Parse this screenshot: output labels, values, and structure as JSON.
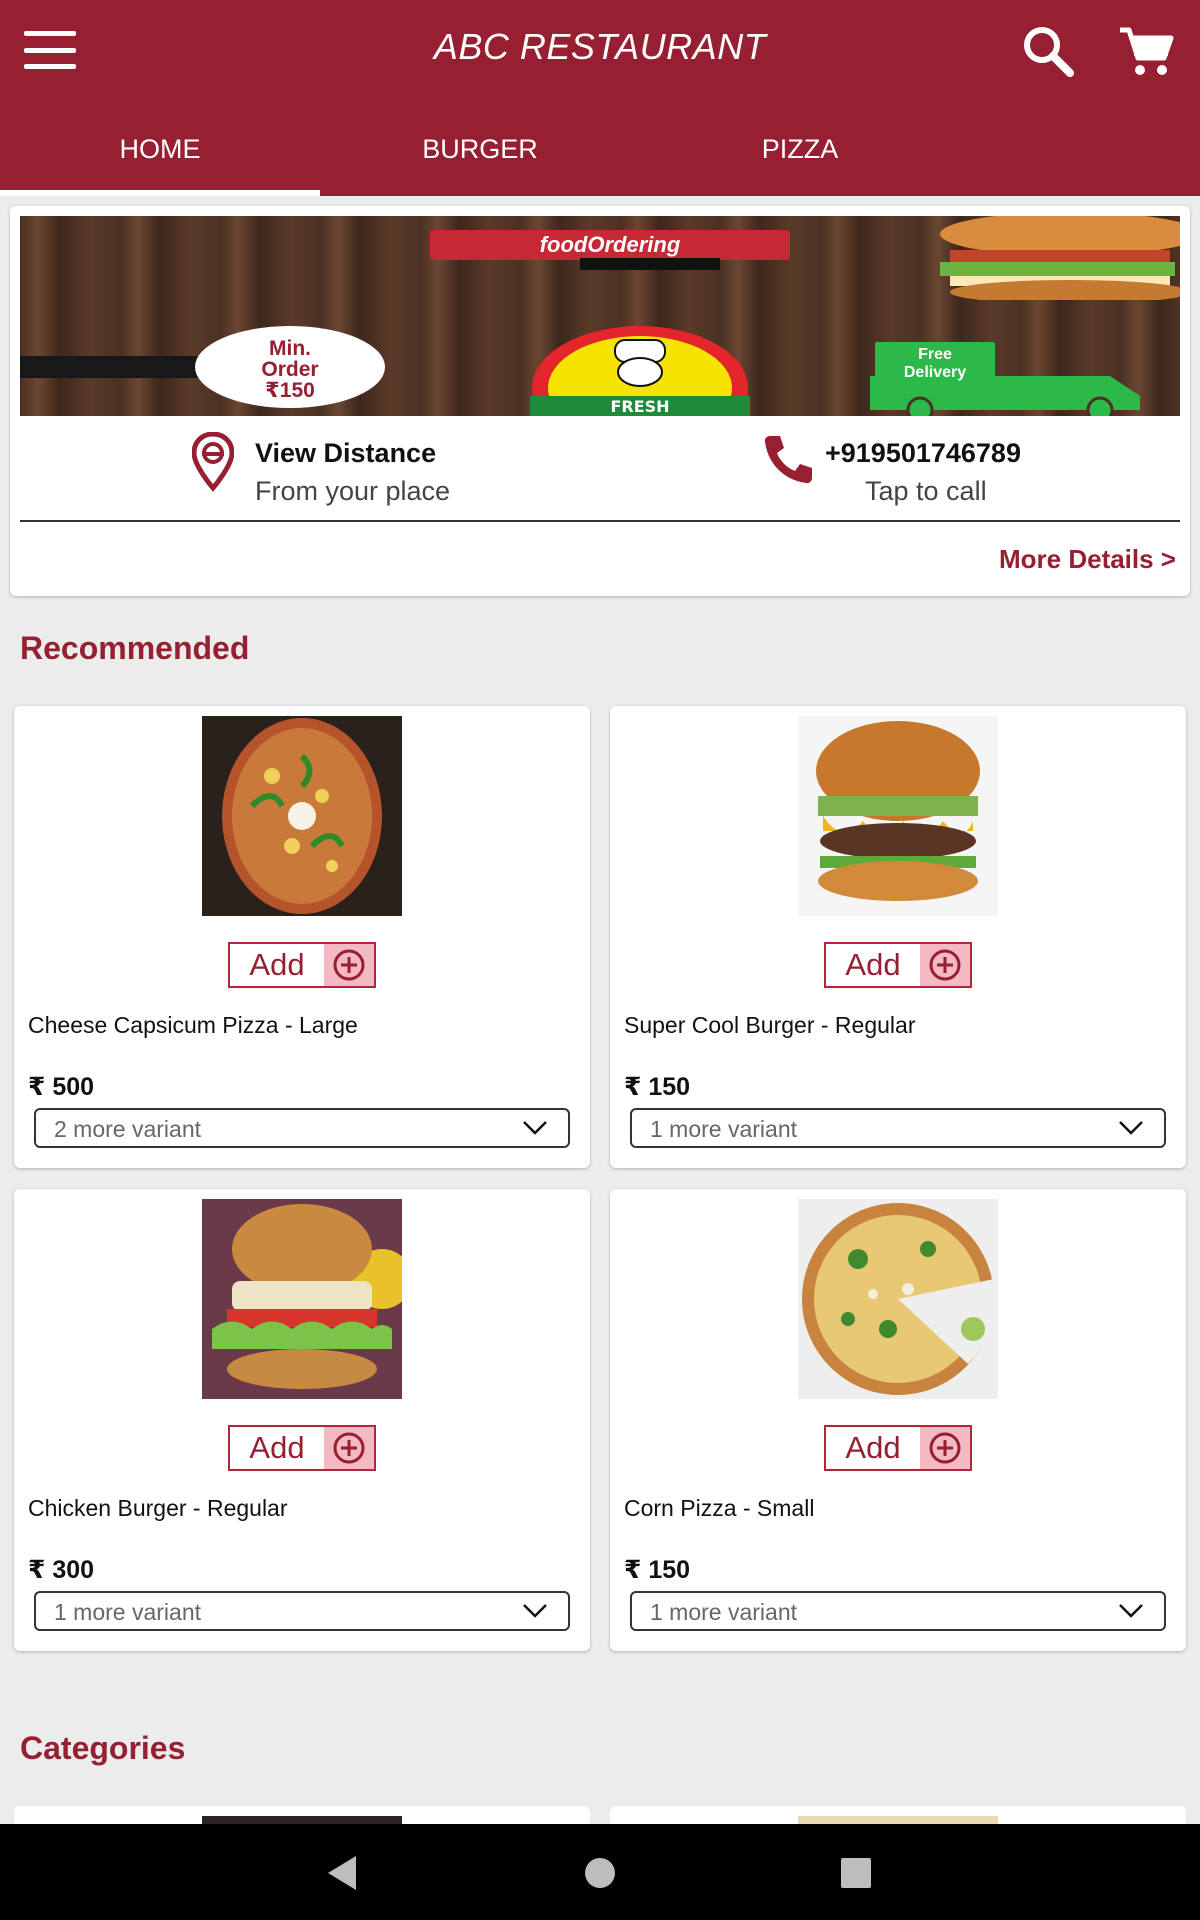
{
  "header": {
    "title": "ABC RESTAURANT",
    "menu_icon": "hamburger-menu-icon",
    "search_icon": "search-icon",
    "cart_icon": "shopping-cart-icon",
    "bar_color": "#962031"
  },
  "tabs": [
    {
      "label": "HOME",
      "active": true
    },
    {
      "label": "BURGER",
      "active": false
    },
    {
      "label": "PIZZA",
      "active": false
    }
  ],
  "banner": {
    "brand": "foodOrdering",
    "min_order": [
      "Min.",
      "Order",
      "₹150"
    ],
    "badge": "FRESH",
    "delivery": [
      "Free",
      "Delivery"
    ]
  },
  "info": {
    "distance_title": "View Distance",
    "distance_subtitle": "From your place",
    "phone": "+919501746789",
    "phone_subtitle": "Tap to call",
    "more_details": "More Details >"
  },
  "recommended": {
    "title": "Recommended",
    "add_label": "Add",
    "items": [
      {
        "name": "Cheese Capsicum Pizza - Large",
        "price": "₹ 500",
        "variant": "2 more variant",
        "image": "pizza"
      },
      {
        "name": "Super Cool Burger - Regular",
        "price": "₹ 150",
        "variant": "1 more variant",
        "image": "burger"
      },
      {
        "name": "Chicken Burger - Regular",
        "price": "₹ 300",
        "variant": "1 more variant",
        "image": "burger"
      },
      {
        "name": "Corn Pizza - Small",
        "price": "₹ 150",
        "variant": "1 more variant",
        "image": "pizza"
      }
    ]
  },
  "categories": {
    "title": "Categories"
  },
  "system_nav": {
    "back_icon": "back-icon",
    "home_icon": "home-icon",
    "recents_icon": "recents-icon"
  }
}
